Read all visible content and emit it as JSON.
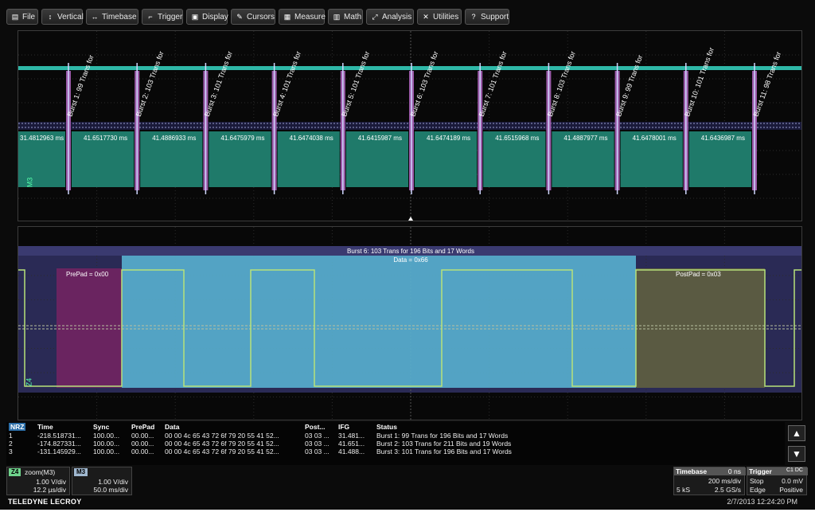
{
  "menu": [
    {
      "icon": "▤",
      "label": "File"
    },
    {
      "icon": "↕",
      "label": "Vertical"
    },
    {
      "icon": "↔",
      "label": "Timebase"
    },
    {
      "icon": "⌐",
      "label": "Trigger"
    },
    {
      "icon": "▣",
      "label": "Display"
    },
    {
      "icon": "✎",
      "label": "Cursors"
    },
    {
      "icon": "▦",
      "label": "Measure"
    },
    {
      "icon": "▥",
      "label": "Math"
    },
    {
      "icon": "⤢",
      "label": "Analysis"
    },
    {
      "icon": "✕",
      "label": "Utilities"
    },
    {
      "icon": "?",
      "label": "Support"
    }
  ],
  "upper_trace": {
    "channel_label": "M3",
    "burst_labels": [
      "Burst 1: 99 Trans for",
      "Burst 2: 103 Trans for",
      "Burst 3: 101 Trans for",
      "Burst 4: 101 Trans for",
      "Burst 5: 101 Trans for",
      "Burst 6: 103 Trans for",
      "Burst 7: 101 Trans for",
      "Burst 8: 103 Trans for",
      "Burst 9: 99 Trans for",
      "Burst 10: 101 Trans for",
      "Burst 11: 98 Trans for"
    ],
    "ifg_labels": [
      "31.4812963 ms",
      "41.6517730 ms",
      "41.4886933 ms",
      "41.6475979 ms",
      "41.6474038 ms",
      "41.6415987 ms",
      "41.6474189 ms",
      "41.6515968 ms",
      "41.4887977 ms",
      "41.6478001 ms",
      "41.6436987 ms"
    ]
  },
  "lower_trace": {
    "channel_label": "Z4",
    "burst_header": "Burst 6: 103 Trans for 196 Bits and 17 Words",
    "data_label": "Data = 0x66",
    "prepad_label": "PrePad = 0x00",
    "postpad_label": "PostPad = 0x03"
  },
  "table": {
    "tag": "NRZ",
    "headers": [
      "Time",
      "Sync",
      "PrePad",
      "Data",
      "Post...",
      "IFG",
      "Status"
    ],
    "rows": [
      {
        "idx": "1",
        "time": "-218.518731...",
        "sync": "100.00...",
        "prepad": "00.00...",
        "data": "00 00 4c 65 43 72 6f 79 20 55 41 52...",
        "post": "03 03 ...",
        "ifg": "31.481...",
        "status": "Burst 1: 99 Trans for 196 Bits and 17 Words"
      },
      {
        "idx": "2",
        "time": "-174.827331...",
        "sync": "100.00...",
        "prepad": "00.00...",
        "data": "00 00 4c 65 43 72 6f 79 20 55 41 52...",
        "post": "03 03 ...",
        "ifg": "41.651...",
        "status": "Burst 2: 103 Trans for 211 Bits and 19 Words"
      },
      {
        "idx": "3",
        "time": "-131.145929...",
        "sync": "100.00...",
        "prepad": "00.00...",
        "data": "00 00 4c 65 43 72 6f 79 20 55 41 52...",
        "post": "03 03 ...",
        "ifg": "41.488...",
        "status": "Burst 3: 101 Trans for 196 Bits and 17 Words"
      }
    ]
  },
  "z4_box": {
    "tag": "Z4",
    "title": "zoom(M3)",
    "vdiv": "1.00 V/div",
    "tdiv": "12.2 µs/div"
  },
  "m3_box": {
    "tag": "M3",
    "vdiv": "1.00 V/div",
    "tdiv": "50.0 ms/div"
  },
  "timebase_box": {
    "title": "Timebase",
    "offset": "0 ns",
    "tdiv": "200 ms/div",
    "samples": "5 kS",
    "rate": "2.5 GS/s"
  },
  "trigger_box": {
    "title": "Trigger",
    "mode_icons": "C1 DC",
    "stop": "Stop",
    "level": "0.0 mV",
    "type": "Edge",
    "slope": "Positive"
  },
  "status_bar": {
    "brand": "TELEDYNE LECROY",
    "datetime": "2/7/2013 12:24:20 PM"
  },
  "colors": {
    "teal": "#1f7a6a",
    "data_blue": "#5ab8d8",
    "prepad": "#6a2460",
    "postpad": "#5a5a42",
    "trace_green": "#b8e27a"
  }
}
